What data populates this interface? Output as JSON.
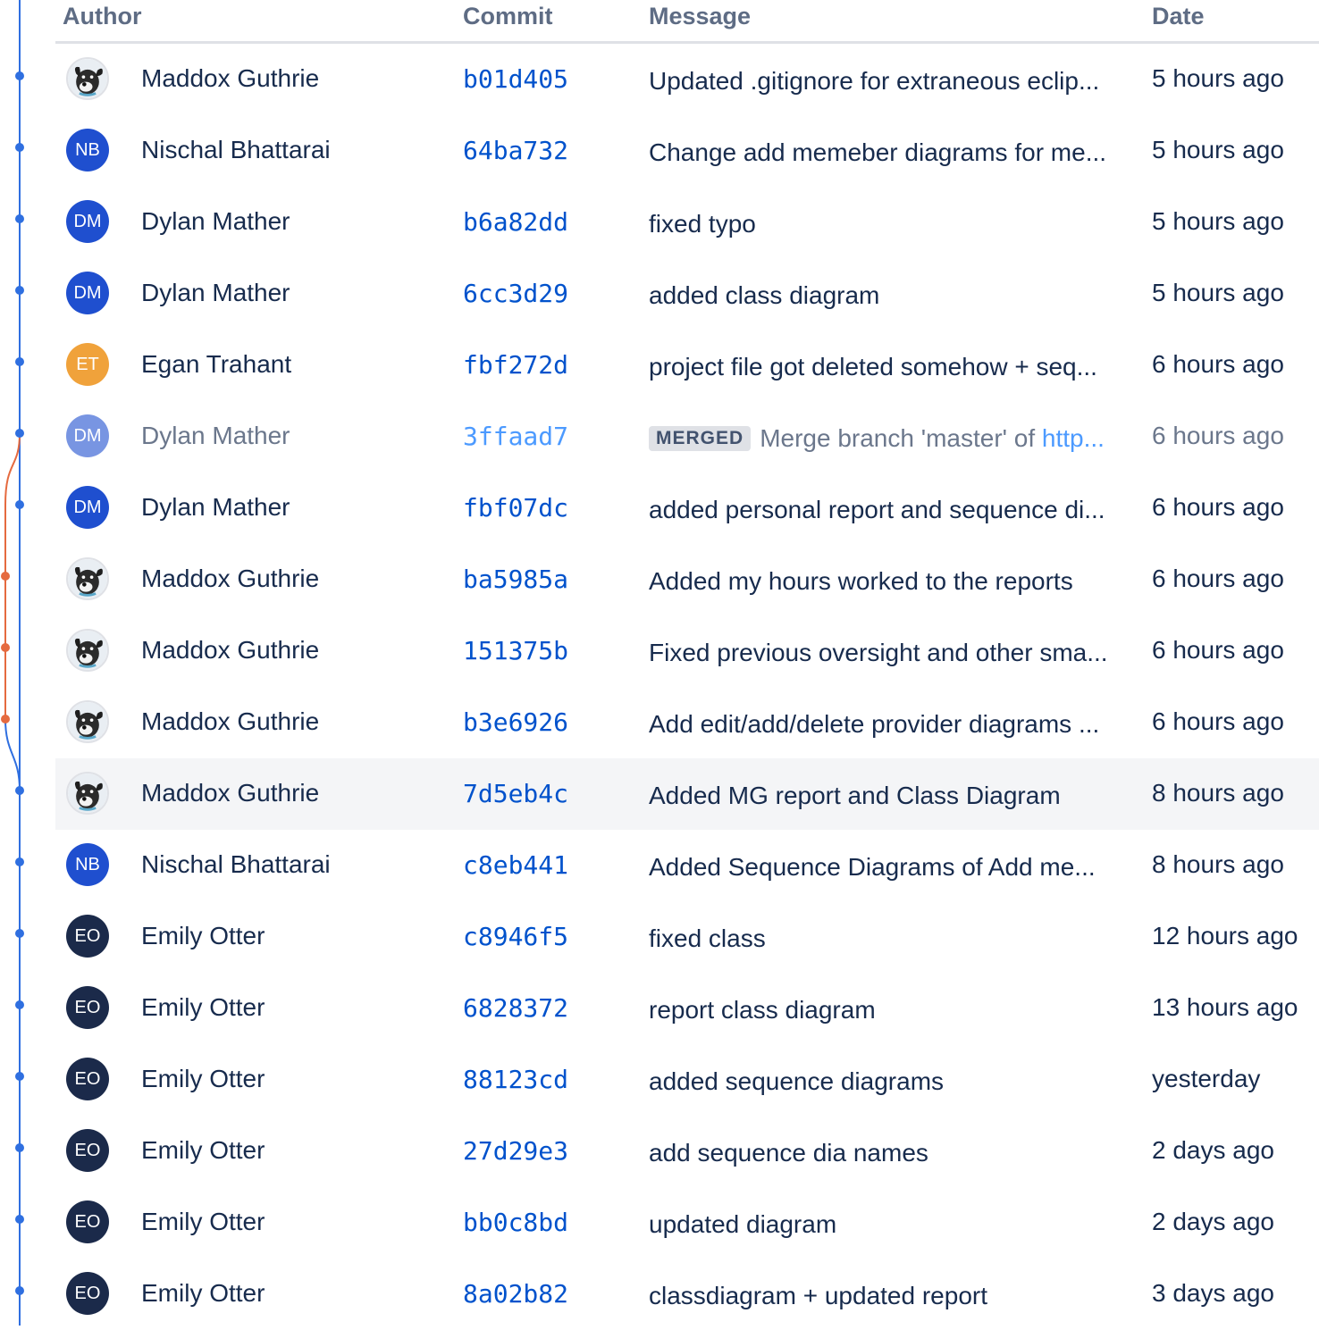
{
  "headers": {
    "author": "Author",
    "commit": "Commit",
    "message": "Message",
    "date": "Date"
  },
  "colors": {
    "branch_main": "#2f6fe0",
    "branch_side": "#e56a3f",
    "link": "#0052cc",
    "row_highlight": "#f4f5f7"
  },
  "commits": [
    {
      "author": "Maddox Guthrie",
      "initials": "",
      "avatar": "dog-photo-avatar",
      "avatar_color": "",
      "hash": "b01d405",
      "message": "Updated .gitignore for extraneous eclip...",
      "date": "5 hours ago",
      "branch": "main"
    },
    {
      "author": "Nischal Bhattarai",
      "initials": "NB",
      "avatar": "initials",
      "avatar_color": "#1f4fcf",
      "hash": "64ba732",
      "message": "Change add memeber diagrams for me...",
      "date": "5 hours ago",
      "branch": "main"
    },
    {
      "author": "Dylan Mather",
      "initials": "DM",
      "avatar": "initials",
      "avatar_color": "#1f4fcf",
      "hash": "b6a82dd",
      "message": "fixed typo",
      "date": "5 hours ago",
      "branch": "main"
    },
    {
      "author": "Dylan Mather",
      "initials": "DM",
      "avatar": "initials",
      "avatar_color": "#1f4fcf",
      "hash": "6cc3d29",
      "message": "added class diagram",
      "date": "5 hours ago",
      "branch": "main"
    },
    {
      "author": "Egan Trahant",
      "initials": "ET",
      "avatar": "initials",
      "avatar_color": "#f0a23b",
      "hash": "fbf272d",
      "message": "project file got deleted somehow + seq...",
      "date": "6 hours ago",
      "branch": "main"
    },
    {
      "author": "Dylan Mather",
      "initials": "DM",
      "avatar": "initials",
      "avatar_color": "#1f4fcf",
      "hash": "3ffaad7",
      "badge": "MERGED",
      "message": "Merge branch 'master' of ",
      "message_link": "http...",
      "date": "6 hours ago",
      "branch": "main",
      "merged": true
    },
    {
      "author": "Dylan Mather",
      "initials": "DM",
      "avatar": "initials",
      "avatar_color": "#1f4fcf",
      "hash": "fbf07dc",
      "message": "added personal report and sequence di...",
      "date": "6 hours ago",
      "branch": "main"
    },
    {
      "author": "Maddox Guthrie",
      "initials": "",
      "avatar": "dog-photo-avatar",
      "avatar_color": "",
      "hash": "ba5985a",
      "message": "Added my hours worked to the reports",
      "date": "6 hours ago",
      "branch": "side"
    },
    {
      "author": "Maddox Guthrie",
      "initials": "",
      "avatar": "dog-photo-avatar",
      "avatar_color": "",
      "hash": "151375b",
      "message": "Fixed previous oversight and other sma...",
      "date": "6 hours ago",
      "branch": "side"
    },
    {
      "author": "Maddox Guthrie",
      "initials": "",
      "avatar": "dog-photo-avatar",
      "avatar_color": "",
      "hash": "b3e6926",
      "message": "Add edit/add/delete provider diagrams ...",
      "date": "6 hours ago",
      "branch": "side"
    },
    {
      "author": "Maddox Guthrie",
      "initials": "",
      "avatar": "dog-photo-avatar",
      "avatar_color": "",
      "hash": "7d5eb4c",
      "message": "Added MG report and Class Diagram",
      "date": "8 hours ago",
      "branch": "main",
      "highlight": true
    },
    {
      "author": "Nischal Bhattarai",
      "initials": "NB",
      "avatar": "initials",
      "avatar_color": "#1f4fcf",
      "hash": "c8eb441",
      "message": "Added Sequence Diagrams of Add me...",
      "date": "8 hours ago",
      "branch": "main"
    },
    {
      "author": "Emily Otter",
      "initials": "EO",
      "avatar": "initials",
      "avatar_color": "#1b2a4a",
      "hash": "c8946f5",
      "message": "fixed class",
      "date": "12 hours ago",
      "branch": "main"
    },
    {
      "author": "Emily Otter",
      "initials": "EO",
      "avatar": "initials",
      "avatar_color": "#1b2a4a",
      "hash": "6828372",
      "message": "report class diagram",
      "date": "13 hours ago",
      "branch": "main"
    },
    {
      "author": "Emily Otter",
      "initials": "EO",
      "avatar": "initials",
      "avatar_color": "#1b2a4a",
      "hash": "88123cd",
      "message": "added sequence diagrams",
      "date": "yesterday",
      "branch": "main"
    },
    {
      "author": "Emily Otter",
      "initials": "EO",
      "avatar": "initials",
      "avatar_color": "#1b2a4a",
      "hash": "27d29e3",
      "message": "add sequence dia names",
      "date": "2 days ago",
      "branch": "main"
    },
    {
      "author": "Emily Otter",
      "initials": "EO",
      "avatar": "initials",
      "avatar_color": "#1b2a4a",
      "hash": "bb0c8bd",
      "message": "updated diagram",
      "date": "2 days ago",
      "branch": "main"
    },
    {
      "author": "Emily Otter",
      "initials": "EO",
      "avatar": "initials",
      "avatar_color": "#1b2a4a",
      "hash": "8a02b82",
      "message": "classdiagram + updated report",
      "date": "3 days ago",
      "branch": "main"
    }
  ]
}
